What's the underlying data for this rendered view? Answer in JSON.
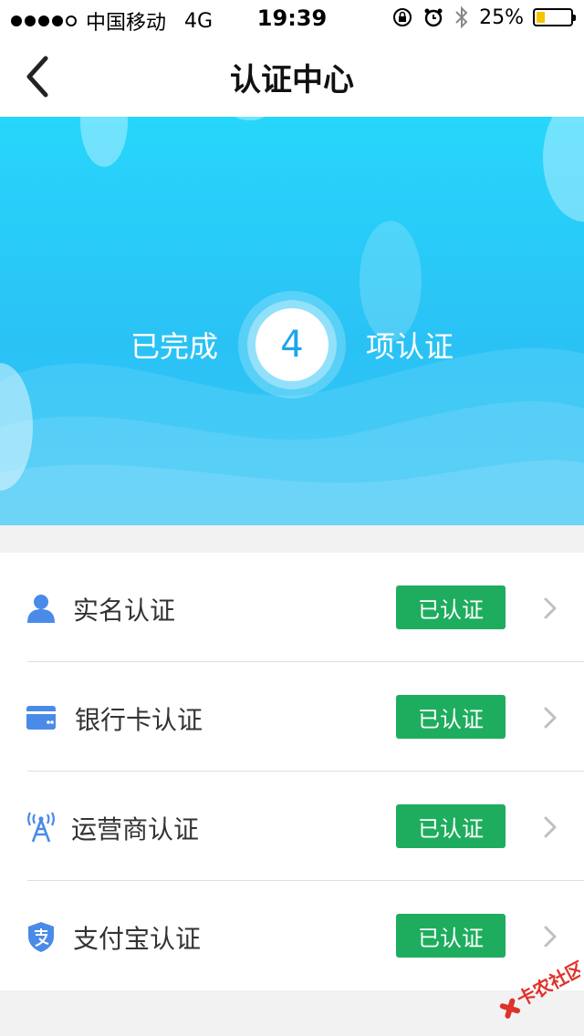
{
  "status_bar": {
    "carrier": "中国移动",
    "network": "4G",
    "time": "19:39",
    "battery_percent": "25%",
    "battery_level": 0.25
  },
  "nav": {
    "title": "认证中心",
    "back_icon": "chevron-left-icon"
  },
  "hero": {
    "prefix": "已完成",
    "count": "4",
    "suffix": "项认证"
  },
  "verifications": [
    {
      "icon": "user-icon",
      "label": "实名认证",
      "status": "已认证"
    },
    {
      "icon": "bank-card-icon",
      "label": "银行卡认证",
      "status": "已认证"
    },
    {
      "icon": "signal-tower-icon",
      "label": "运营商认证",
      "status": "已认证"
    },
    {
      "icon": "alipay-shield-icon",
      "label": "支付宝认证",
      "status": "已认证"
    }
  ],
  "watermark": {
    "text": "卡农社区"
  },
  "colors": {
    "accent_blue": "#1ea6ea",
    "icon_blue": "#4a8be8",
    "badge_green": "#1ead5e",
    "hero_top": "#27d6fb",
    "hero_bottom": "#34c5f5"
  }
}
